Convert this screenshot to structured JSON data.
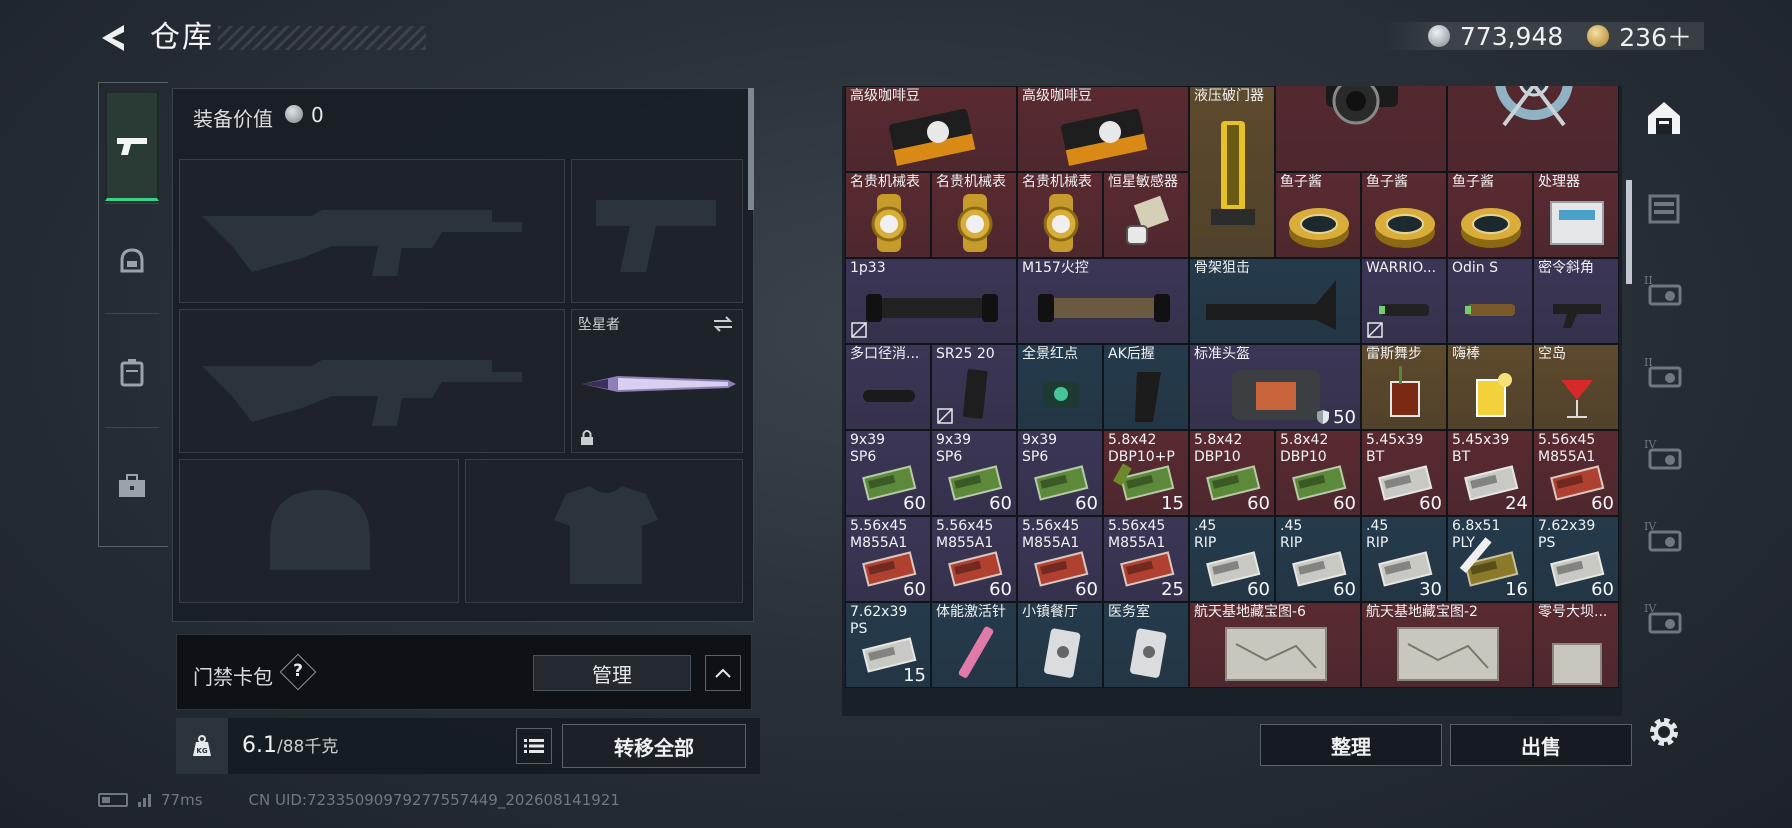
{
  "header": {
    "title": "仓库",
    "back_icon": "back-arrow-icon",
    "currency": [
      {
        "icon": "silver-coin-icon",
        "value": "773,948"
      },
      {
        "icon": "gold-coin-icon",
        "value": "236＋"
      }
    ]
  },
  "left_nav": [
    {
      "icon": "pistol-icon",
      "active": true
    },
    {
      "icon": "helmet-icon",
      "active": false
    },
    {
      "icon": "backpack-icon",
      "active": false
    },
    {
      "icon": "briefcase-icon",
      "active": false
    }
  ],
  "equipment": {
    "title": "装备价值",
    "value": "0",
    "melee_slot_label": "坠星者"
  },
  "access_card": {
    "label": "门禁卡包",
    "help": "?",
    "manage_label": "管理"
  },
  "weight": {
    "value": "6.1",
    "capacity": "/88千克",
    "transfer_all_label": "转移全部"
  },
  "status": {
    "ping": "77ms",
    "uid": "CN UID:72335090979277557449_202608141921"
  },
  "storage": {
    "items": [
      {
        "name": "高级咖啡豆",
        "count": ""
      },
      {
        "name": "高级咖啡豆",
        "count": ""
      },
      {
        "name": "液压破门器",
        "count": ""
      },
      {
        "name": "",
        "count": ""
      },
      {
        "name": "",
        "count": ""
      },
      {
        "name": "名贵机械表",
        "count": ""
      },
      {
        "name": "名贵机械表",
        "count": ""
      },
      {
        "name": "名贵机械表",
        "count": ""
      },
      {
        "name": "恒星敏感器",
        "count": ""
      },
      {
        "name": "鱼子酱",
        "count": ""
      },
      {
        "name": "鱼子酱",
        "count": ""
      },
      {
        "name": "鱼子酱",
        "count": ""
      },
      {
        "name": "处理器",
        "count": ""
      },
      {
        "name": "1p33",
        "count": ""
      },
      {
        "name": "M157火控",
        "count": ""
      },
      {
        "name": "骨架狙击",
        "count": ""
      },
      {
        "name": "WARRIO...",
        "count": ""
      },
      {
        "name": "Odin S",
        "count": ""
      },
      {
        "name": "密令斜角",
        "count": ""
      },
      {
        "name": "多口径消...",
        "count": ""
      },
      {
        "name": "SR25 20",
        "count": ""
      },
      {
        "name": "全景红点",
        "count": ""
      },
      {
        "name": "AK后握",
        "count": ""
      },
      {
        "name": "标准头盔",
        "count": "50"
      },
      {
        "name": "雷斯舞步",
        "count": ""
      },
      {
        "name": "嗨棒",
        "count": ""
      },
      {
        "name": "空岛",
        "count": ""
      },
      {
        "name": "9x39",
        "name2": "SP6",
        "count": "60"
      },
      {
        "name": "9x39",
        "name2": "SP6",
        "count": "60"
      },
      {
        "name": "9x39",
        "name2": "SP6",
        "count": "60"
      },
      {
        "name": "5.8x42",
        "name2": "DBP10+P",
        "count": "15"
      },
      {
        "name": "5.8x42",
        "name2": "DBP10",
        "count": "60"
      },
      {
        "name": "5.8x42",
        "name2": "DBP10",
        "count": "60"
      },
      {
        "name": "5.45x39",
        "name2": "BT",
        "count": "60"
      },
      {
        "name": "5.45x39",
        "name2": "BT",
        "count": "24"
      },
      {
        "name": "5.56x45",
        "name2": "M855A1",
        "count": "60"
      },
      {
        "name": "5.56x45",
        "name2": "M855A1",
        "count": "60"
      },
      {
        "name": "5.56x45",
        "name2": "M855A1",
        "count": "60"
      },
      {
        "name": "5.56x45",
        "name2": "M855A1",
        "count": "60"
      },
      {
        "name": "5.56x45",
        "name2": "M855A1",
        "count": "25"
      },
      {
        "name": ".45",
        "name2": "RIP",
        "count": "60"
      },
      {
        "name": ".45",
        "name2": "RIP",
        "count": "60"
      },
      {
        "name": ".45",
        "name2": "RIP",
        "count": "30"
      },
      {
        "name": "6.8x51",
        "name2": "PLY",
        "count": "16"
      },
      {
        "name": "7.62x39",
        "name2": "PS",
        "count": "60"
      },
      {
        "name": "7.62x39",
        "name2": "PS",
        "count": "15"
      },
      {
        "name": "体能激活针",
        "count": ""
      },
      {
        "name": "小镇餐厅",
        "count": ""
      },
      {
        "name": "医务室",
        "count": ""
      },
      {
        "name": "航天基地藏宝图-6",
        "count": ""
      },
      {
        "name": "航天基地藏宝图-2",
        "count": ""
      },
      {
        "name": "零号大坝...",
        "count": ""
      }
    ]
  },
  "right_rail": [
    {
      "icon": "storage-home-icon",
      "label": ""
    },
    {
      "icon": "shelf-icon",
      "label": ""
    },
    {
      "icon": "workbench-ii-icon",
      "label": "II"
    },
    {
      "icon": "workbench-ii-b-icon",
      "label": "II"
    },
    {
      "icon": "workbench-iv-icon",
      "label": "IV"
    },
    {
      "icon": "workbench-iv-b-icon",
      "label": "IV"
    },
    {
      "icon": "workbench-iv-c-icon",
      "label": "IV"
    }
  ],
  "footer_buttons": {
    "sort_label": "整理",
    "sell_label": "出售"
  },
  "colors": {
    "accent_green": "#35d28a",
    "rarity_red": "#5a2a30",
    "rarity_gold": "#5e4a2c",
    "rarity_purple": "#3c3656",
    "rarity_blue": "#253b4c",
    "rarity_green": "#2a3c33"
  }
}
